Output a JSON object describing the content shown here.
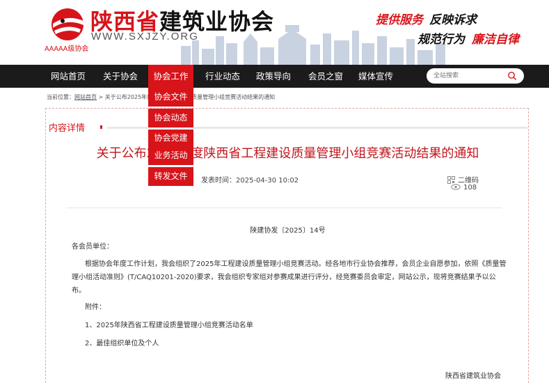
{
  "header": {
    "site_name_red": "陕西省",
    "site_name_black": "建筑业协会",
    "url": "WWW.SXJZY.ORG",
    "badge": "AAAAA级协会",
    "slogans": [
      "提供服务",
      "反映诉求",
      "规范行为",
      "廉洁自律"
    ]
  },
  "nav": {
    "items": [
      "网站首页",
      "关于协会",
      "协会工作",
      "行业动态",
      "政策导向",
      "会员之窗",
      "媒体宣传"
    ],
    "active_index": 2,
    "search_placeholder": "全站搜索"
  },
  "dropdown": {
    "items": [
      "协会文件",
      "协会动态",
      "协会党建",
      "业务活动",
      "转发文件"
    ]
  },
  "breadcrumb": {
    "prefix": "当前位置：",
    "home": "网站首页",
    "sep": " > ",
    "current": "关于公布2025年度陕西省工程建设质量管理小组竞赛活动结果的通知"
  },
  "article": {
    "section_title": "内容详情",
    "title": "关于公布2025年度陕西省工程建设质量管理小组竞赛活动结果的通知",
    "publish_time": "发表时间：2025-04-30 10:02",
    "qr_label": "二维码",
    "views": "108",
    "doc_number": "陕建协发〔2025〕14号",
    "salutation": "各会员单位：",
    "body": "根据协会年度工作计划，我会组织了2025年工程建设质量管理小组竞赛活动。经各地市行业协会推荐，会员企业自愿参加，依照《质量管理小组活动准则》(T/CAQ10201-2020)要求，我会组织专家组对参赛成果进行评分，经竞赛委员会审定，网站公示，现将竞赛结果予以公布。",
    "attach_label": "附件：",
    "attachments": [
      "1、2025年陕西省工程建设质量管理小组竞赛活动名单",
      "2、最佳组织单位及个人"
    ],
    "signature": "陕西省建筑业协会"
  },
  "colors": {
    "brand_red": "#d7141a",
    "nav_bg": "#1b1b1b"
  }
}
